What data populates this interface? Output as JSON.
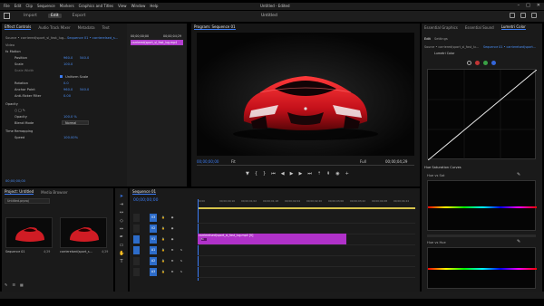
{
  "menubar": {
    "items": [
      "File",
      "Edit",
      "Clip",
      "Sequence",
      "Markers",
      "Graphics and Titles",
      "View",
      "Window",
      "Help"
    ],
    "title": "Untitled - Edited"
  },
  "workspace": {
    "tabs": [
      "Import",
      "Edit",
      "Export"
    ],
    "active_tab": "Edit",
    "docname": "Untitled"
  },
  "effect_controls": {
    "tabs": [
      "Effect Controls",
      "Audio Track Mixer",
      "Metadata",
      "Text"
    ],
    "active": "Effect Controls",
    "source_label": "Source • carriered(sport_sl_fast_lug...",
    "sequence_label": "Sequence 01 • carrierelsed_s...",
    "video_header": "Video",
    "motion": "Motion",
    "position_label": "Position",
    "position_x": "960.0",
    "position_y": "540.0",
    "scale_label": "Scale",
    "scale_value": "100.0",
    "scale_width_label": "Scale Width",
    "uniform_scale_label": "Uniform Scale",
    "rotation_label": "Rotation",
    "rotation_value": "0.0",
    "anchor_label": "Anchor Point",
    "anchor_x": "960.0",
    "anchor_y": "540.0",
    "antiflicker_label": "Anti-flicker Filter",
    "antiflicker_value": "0.00",
    "opacity_section": "Opacity",
    "opacity_label": "Opacity",
    "opacity_value": "100.0 %",
    "blend_label": "Blend Mode",
    "blend_value": "Normal",
    "time_remap": "Time Remapping",
    "speed_label": "Speed",
    "speed_value": "100.00%",
    "timecode": "00;00;00;00"
  },
  "mini_timeline": {
    "tc1": "00;00;00;00",
    "tc2": "00;00;04;29",
    "clip": "carriered(sport_sl_fast_lug.mp4"
  },
  "program": {
    "title": "Program: Sequence 01",
    "tc_left": "00;00;00;00",
    "fit": "Fit",
    "zoom": "Full",
    "tc_right": "00;00;04;29"
  },
  "lumetri": {
    "tabs": [
      "Essential Graphics",
      "Essential Sound",
      "Lumetri Color"
    ],
    "active": "Lumetri Color",
    "subtabs": [
      "Edit",
      "Settings"
    ],
    "source": "Source • carriered(sport_sl_fast_lu...",
    "sequence": "Sequence 01 • carrierelsed(sport...",
    "lut": "Lumetri Color",
    "hue_sat": "Hue Saturation Curves",
    "hue_vs_sat": "Hue vs Sat",
    "hue_vs_hue": "Hue vs Hue",
    "colors": [
      "#ffffff",
      "#e53b3b",
      "#3ec24b",
      "#3b6ef5"
    ]
  },
  "project": {
    "tabs": [
      "Project: Untitled",
      "Media Browser"
    ],
    "search_placeholder": "Untitled.prproj",
    "items": [
      {
        "name": "Sequence 01",
        "duration": "4;29"
      },
      {
        "name": "carrierelsed(sport_s...",
        "duration": "4;29"
      }
    ]
  },
  "timeline": {
    "title": "Sequence 01",
    "timecode": "00;00;00;00",
    "ruler": [
      "00;00",
      "00;00;00;16",
      "00;00;01;02",
      "00;00;01;18",
      "00;00;02;04",
      "00;00;02;20",
      "00;00;03;06",
      "00;00;03;22",
      "00;00;04;08",
      "00;00;04;24"
    ],
    "tracks": [
      "V3",
      "V2",
      "V1",
      "A1",
      "A2",
      "A3"
    ],
    "clip": "carrierelsed(sport_sl_fast_lug.mp4 [V]"
  }
}
